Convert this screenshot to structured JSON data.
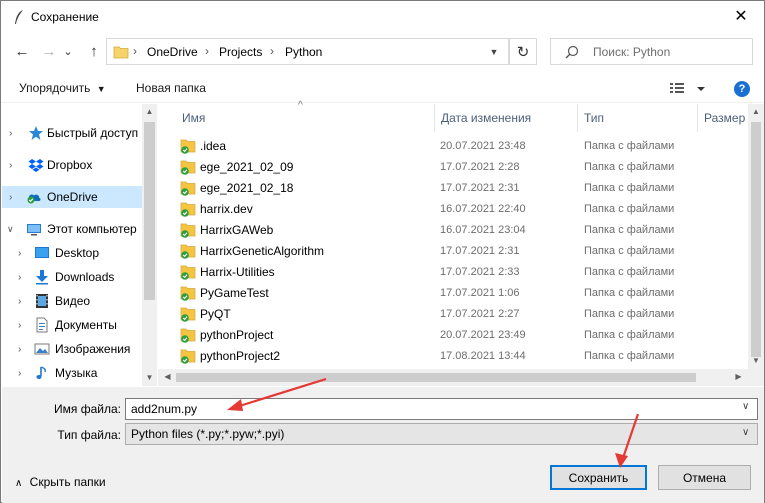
{
  "window": {
    "title": "Сохранение",
    "close_glyph": "✕"
  },
  "nav": {
    "back_glyph": "←",
    "forward_glyph": "→",
    "recent_glyph": "⌄",
    "up_glyph": "↑",
    "breadcrumbs": [
      "OneDrive",
      "Projects",
      "Python"
    ],
    "separator": "›",
    "refresh_glyph": "↻",
    "search_placeholder": "Поиск: Python"
  },
  "toolbar": {
    "organize_label": "Упорядочить",
    "new_folder_label": "Новая папка",
    "help_glyph": "?"
  },
  "sidebar": {
    "items": [
      {
        "label": "Быстрый доступ",
        "icon": "star-icon"
      },
      {
        "label": "Dropbox",
        "icon": "dropbox-icon"
      },
      {
        "label": "OneDrive",
        "icon": "onedrive-icon",
        "selected": true
      },
      {
        "label": "Этот компьютер",
        "icon": "computer-icon",
        "expanded": true
      },
      {
        "label": "Desktop",
        "icon": "desktop-icon"
      },
      {
        "label": "Downloads",
        "icon": "downloads-icon"
      },
      {
        "label": "Видео",
        "icon": "video-icon"
      },
      {
        "label": "Документы",
        "icon": "documents-icon"
      },
      {
        "label": "Изображения",
        "icon": "pictures-icon"
      },
      {
        "label": "Музыка",
        "icon": "music-icon"
      }
    ]
  },
  "filelist": {
    "columns": [
      "Имя",
      "Дата изменения",
      "Тип",
      "Размер"
    ],
    "rows": [
      {
        "name": ".idea",
        "date": "20.07.2021 23:48",
        "type": "Папка с файлами"
      },
      {
        "name": "ege_2021_02_09",
        "date": "17.07.2021 2:28",
        "type": "Папка с файлами"
      },
      {
        "name": "ege_2021_02_18",
        "date": "17.07.2021 2:31",
        "type": "Папка с файлами"
      },
      {
        "name": "harrix.dev",
        "date": "16.07.2021 22:40",
        "type": "Папка с файлами"
      },
      {
        "name": "HarrixGAWeb",
        "date": "16.07.2021 23:04",
        "type": "Папка с файлами"
      },
      {
        "name": "HarrixGeneticAlgorithm",
        "date": "17.07.2021 2:31",
        "type": "Папка с файлами"
      },
      {
        "name": "Harrix-Utilities",
        "date": "17.07.2021 2:33",
        "type": "Папка с файлами"
      },
      {
        "name": "PyGameTest",
        "date": "17.07.2021 1:06",
        "type": "Папка с файлами"
      },
      {
        "name": "PyQT",
        "date": "17.07.2021 2:27",
        "type": "Папка с файлами"
      },
      {
        "name": "pythonProject",
        "date": "20.07.2021 23:49",
        "type": "Папка с файлами"
      },
      {
        "name": "pythonProject2",
        "date": "17.08.2021 13:44",
        "type": "Папка с файлами"
      }
    ]
  },
  "form": {
    "filename_label": "Имя файла:",
    "filename_value": "add2num.py",
    "filetype_label": "Тип файла:",
    "filetype_value": "Python files (*.py;*.pyw;*.pyi)"
  },
  "footer": {
    "hide_folders_label": "Скрыть папки",
    "save_label": "Сохранить",
    "cancel_label": "Отмена"
  },
  "colors": {
    "selection": "#cce8ff",
    "accent": "#0078d7",
    "annotation_arrow": "#e53935",
    "folder": "#f5c542",
    "sync_badge": "#2e9e3e"
  }
}
